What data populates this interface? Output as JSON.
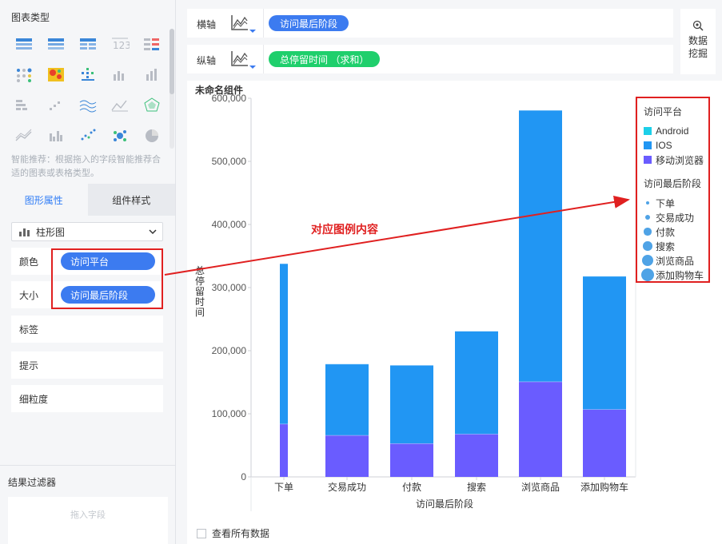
{
  "left_panel": {
    "chart_types_title": "图表类型",
    "smart_hint": "智能推荐：根据拖入的字段智能推荐合适的图表或表格类型。",
    "tabs": [
      {
        "label": "图形属性",
        "active": true
      },
      {
        "label": "组件样式",
        "active": false
      }
    ],
    "chart_type_select": "柱形图",
    "properties": [
      {
        "label": "颜色",
        "field": "访问平台"
      },
      {
        "label": "大小",
        "field": "访问最后阶段"
      },
      {
        "label": "标签",
        "field": ""
      },
      {
        "label": "提示",
        "field": ""
      },
      {
        "label": "细粒度",
        "field": ""
      }
    ],
    "filter_title": "结果过滤器",
    "filter_placeholder": "拖入字段",
    "chart_type_icons": [
      "table-icon",
      "grouped-table-icon",
      "cross-table-icon",
      "number-card-icon",
      "kpi-list-icon",
      "dot-matrix-icon",
      "heatmap-icon",
      "dot-grid-icon",
      "bar-small-icon",
      "column-chart-icon",
      "stacked-blocks-icon",
      "scatter-steps-icon",
      "wave-line-icon",
      "line-chart-icon",
      "radar-icon",
      "area-line-icon",
      "grouped-bar-icon",
      "scatter-icon",
      "bubble-cluster-icon",
      "pie-chart-icon"
    ]
  },
  "axis": {
    "x_label": "横轴",
    "x_field": "访问最后阶段",
    "y_label": "纵轴",
    "y_field": "总停留时间  （求和）",
    "x_pill_color": "#3c7bf0",
    "y_pill_color": "#1fcf6c"
  },
  "mine_button": {
    "line1": "数据",
    "line2": "挖掘"
  },
  "component_title": "未命名组件",
  "annotation": "对应图例内容",
  "show_all_label": "查看所有数据",
  "legend": {
    "color_title": "访问平台",
    "color_items": [
      {
        "name": "Android",
        "color": "#1ccfe8"
      },
      {
        "name": "IOS",
        "color": "#2196f3"
      },
      {
        "name": "移动浏览器",
        "color": "#6a5cff"
      }
    ],
    "size_title": "访问最后阶段",
    "size_items": [
      {
        "name": "下单",
        "size": 1
      },
      {
        "name": "交易成功",
        "size": 2
      },
      {
        "name": "付款",
        "size": 3
      },
      {
        "name": "搜索",
        "size": 4
      },
      {
        "name": "浏览商品",
        "size": 5
      },
      {
        "name": "添加购物车",
        "size": 6
      }
    ]
  },
  "chart_data": {
    "type": "bar",
    "stacked": true,
    "categories": [
      "下单",
      "交易成功",
      "付款",
      "搜索",
      "浏览商品",
      "添加购物车"
    ],
    "series": [
      {
        "name": "移动浏览器",
        "color": "#6a5cff",
        "values": [
          84000,
          66000,
          53000,
          68000,
          151000,
          107000
        ]
      },
      {
        "name": "IOS",
        "color": "#2196f3",
        "values": [
          254000,
          113000,
          124000,
          163000,
          430000,
          211000
        ]
      },
      {
        "name": "Android",
        "color": "#1ccfe8",
        "values": [
          0,
          0,
          0,
          0,
          0,
          0
        ]
      }
    ],
    "xlabel": "访问最后阶段",
    "ylabel": "总停留时间",
    "ylim": [
      0,
      600000
    ],
    "yticks": [
      0,
      100000,
      200000,
      300000,
      400000,
      500000,
      600000
    ],
    "ytick_labels": [
      "0",
      "100,000",
      "200,000",
      "300,000",
      "400,000",
      "500,000",
      "600,000"
    ],
    "grid": false,
    "legend_position": "right"
  }
}
